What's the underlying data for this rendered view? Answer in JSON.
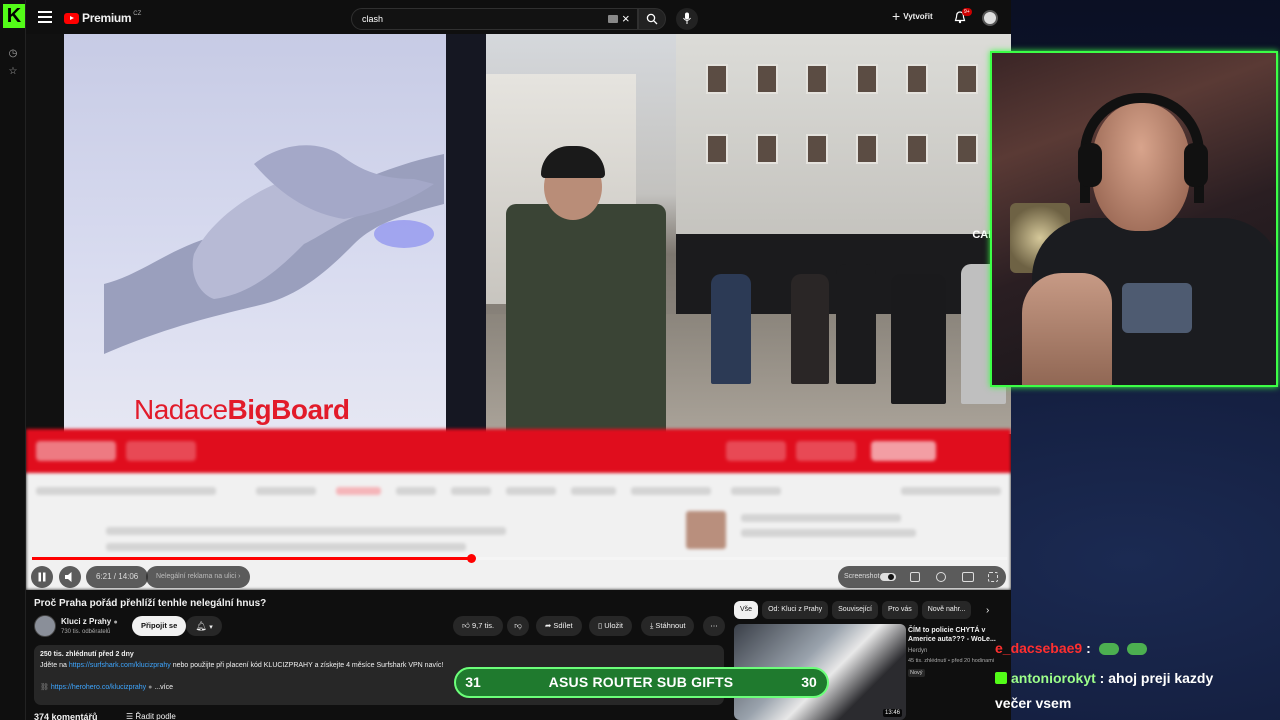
{
  "youtube": {
    "brand": "Premium",
    "brand_region": "CZ",
    "search_query": "clash",
    "create_label": "Vytvořit",
    "notifications_badge": "9+"
  },
  "video": {
    "billboard_text_light": "Nadace",
    "billboard_text_bold": "BigBoard",
    "shop_sign": "CALZE",
    "current_time": "6:21 / 14:06",
    "chapter": "Nelegální reklama na ulici",
    "chapter_arrow": "›",
    "progress_fraction": 0.45,
    "screenshot_label": "Screenshot",
    "title": "Proč Praha pořád přehlíží tenhle nelegální hnus?"
  },
  "channel": {
    "name": "Kluci z Prahy",
    "subscribers": "730 tis. odběratelů",
    "join_label": "Připojit se"
  },
  "actions": {
    "likes": "9,7 tis.",
    "share": "Sdílet",
    "save": "Uložit",
    "download": "Stáhnout",
    "more": "⋯"
  },
  "description": {
    "stats": "250 tis. zhlédnutí  před 2 dny",
    "line_prefix": "Jděte na ",
    "line_link": "https://surfshark.com/klucizprahy",
    "line_suffix": " nebo použijte při placení kód KLUCIZPRAHY a získejte 4 měsíce Surfshark VPN navíc!",
    "link2": "https://herohero.co/klucizprahy",
    "more": "...více"
  },
  "comments": {
    "count": "374 komentářů",
    "sort_label": "Řadit podle"
  },
  "chips": [
    "Vše",
    "Od: Kluci z Prahy",
    "Související",
    "Pro vás",
    "Nově nahr..."
  ],
  "recommendation": {
    "title": "ČÍM to policie CHYTÁ v Americe auta??? - WoLe...",
    "channel": "Herdyn",
    "meta": "45 tis. zhlédnutí • před 20 hodinami",
    "badge": "Nový",
    "duration": "13:46"
  },
  "gifts": {
    "left": "31",
    "label": "ASUS ROUTER SUB GIFTS",
    "right": "30"
  },
  "chat": [
    {
      "user": "e_dacsebae9",
      "sep": " :",
      "text": ""
    },
    {
      "user": "antoniorokyt",
      "sep": " :",
      "text": " ahoj preji kazdy"
    },
    {
      "user": "",
      "sep": "",
      "text": "večer vsem"
    }
  ]
}
